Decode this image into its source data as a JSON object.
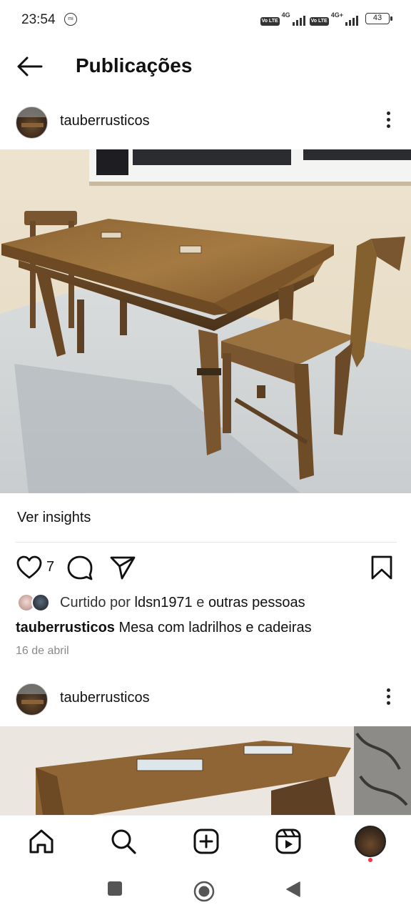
{
  "status_bar": {
    "time": "23:54",
    "mi_label": "mi",
    "volte1": "Vo LTE",
    "gen1": "4G",
    "volte2": "Vo LTE",
    "gen2": "4G+",
    "battery": "43"
  },
  "header": {
    "title": "Publicações"
  },
  "posts": [
    {
      "username": "tauberrusticos",
      "insights_label": "Ver insights",
      "likes_count": "7",
      "liked_by_prefix": "Curtido por",
      "liked_by_user": "ldsn1971",
      "liked_by_join": "e",
      "liked_by_others": "outras pessoas",
      "caption_user": "tauberrusticos",
      "caption_text": "Mesa com ladrilhos e cadeiras",
      "date": "16 de abril"
    },
    {
      "username": "tauberrusticos"
    }
  ],
  "icons": {
    "back": "back-arrow-icon",
    "more": "more-options-icon",
    "like": "heart-icon",
    "comment": "comment-icon",
    "share": "send-icon",
    "save": "bookmark-icon",
    "home": "home-icon",
    "search": "search-icon",
    "create": "add-post-icon",
    "reels": "reels-icon",
    "profile": "profile-avatar",
    "sys_recent": "square-icon",
    "sys_home": "circle-icon",
    "sys_back": "triangle-back-icon"
  },
  "colors": {
    "notification_dot": "#ff3040",
    "date_text": "#8a8a8a"
  }
}
